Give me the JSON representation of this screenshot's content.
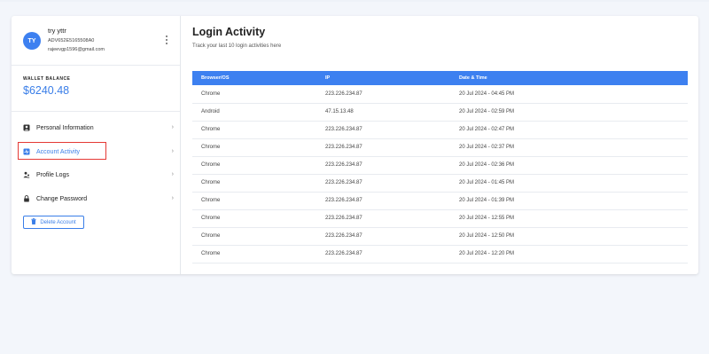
{
  "profile": {
    "initials": "TY",
    "name": "try yttr",
    "id": "ADV652E5165508A0",
    "email": "rajeevgp1596@gmail.com"
  },
  "wallet": {
    "label": "WALLET BALANCE",
    "amount": "$6240.48"
  },
  "menu": [
    {
      "label": "Personal Information",
      "icon": "person-badge-icon",
      "active": false
    },
    {
      "label": "Account Activity",
      "icon": "activity-icon",
      "active": true
    },
    {
      "label": "Profile Logs",
      "icon": "users-icon",
      "active": false
    },
    {
      "label": "Change Password",
      "icon": "lock-icon",
      "active": false
    }
  ],
  "delete_button": {
    "label": "Delete Account",
    "icon": "trash-icon"
  },
  "main": {
    "title": "Login Activity",
    "subtitle": "Track your last 10 login activities here"
  },
  "table": {
    "headers": [
      "Browser/OS",
      "IP",
      "Date & Time"
    ],
    "rows": [
      [
        "Chrome",
        "223.226.234.87",
        "20 Jul 2024 - 04:45 PM"
      ],
      [
        "Android",
        "47.15.13.48",
        "20 Jul 2024 - 02:59 PM"
      ],
      [
        "Chrome",
        "223.226.234.87",
        "20 Jul 2024 - 02:47 PM"
      ],
      [
        "Chrome",
        "223.226.234.87",
        "20 Jul 2024 - 02:37 PM"
      ],
      [
        "Chrome",
        "223.226.234.87",
        "20 Jul 2024 - 02:36 PM"
      ],
      [
        "Chrome",
        "223.226.234.87",
        "20 Jul 2024 - 01:45 PM"
      ],
      [
        "Chrome",
        "223.226.234.87",
        "20 Jul 2024 - 01:39 PM"
      ],
      [
        "Chrome",
        "223.226.234.87",
        "20 Jul 2024 - 12:55 PM"
      ],
      [
        "Chrome",
        "223.226.234.87",
        "20 Jul 2024 - 12:50 PM"
      ],
      [
        "Chrome",
        "223.226.234.87",
        "20 Jul 2024 - 12:20 PM"
      ]
    ]
  },
  "colors": {
    "accent": "#3d80f0",
    "highlight_box": "#e53935",
    "background": "#f3f6fb"
  }
}
